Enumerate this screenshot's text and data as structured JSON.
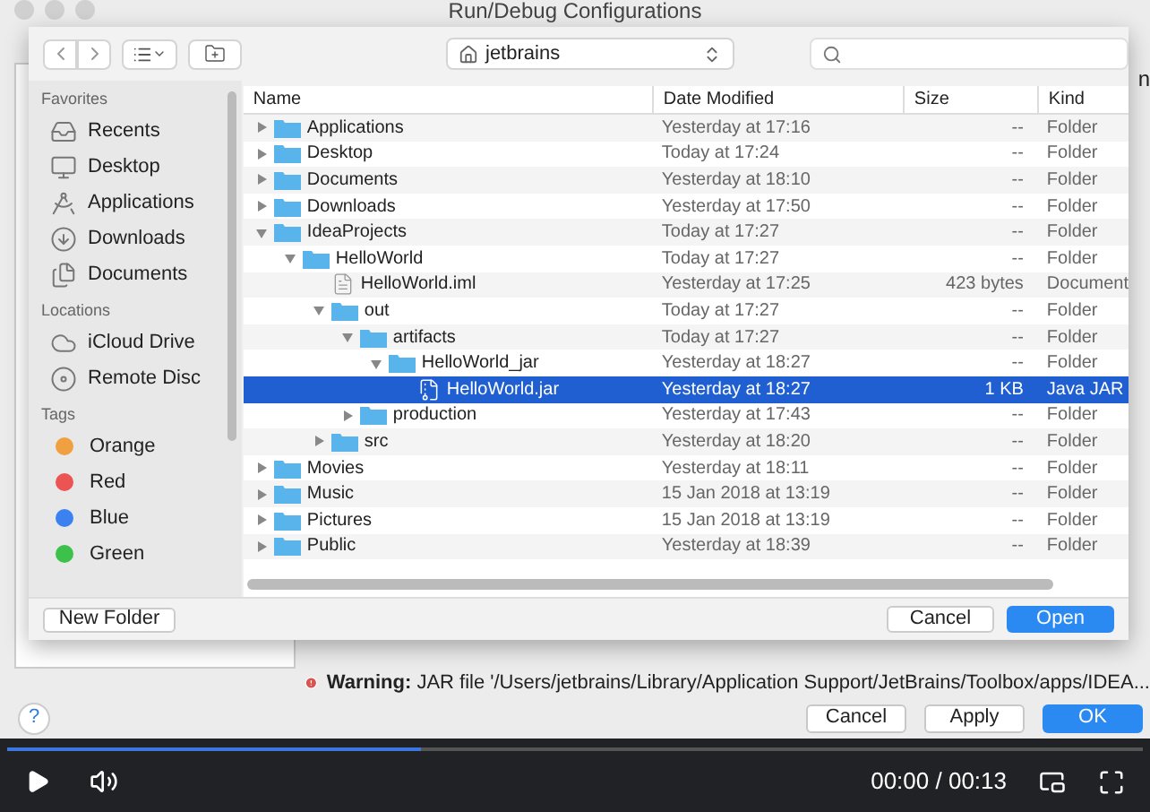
{
  "window": {
    "title": "Run/Debug Configurations",
    "cut_label": "n"
  },
  "toolbar": {
    "location": "jetbrains"
  },
  "sidebar": {
    "sections": [
      {
        "title": "Favorites",
        "items": [
          {
            "label": "Recents",
            "kind": "recents"
          },
          {
            "label": "Desktop",
            "kind": "desktop"
          },
          {
            "label": "Applications",
            "kind": "applications"
          },
          {
            "label": "Downloads",
            "kind": "downloads"
          },
          {
            "label": "Documents",
            "kind": "documents"
          }
        ]
      },
      {
        "title": "Locations",
        "items": [
          {
            "label": "iCloud Drive",
            "kind": "cloud"
          },
          {
            "label": "Remote Disc",
            "kind": "disc"
          }
        ]
      },
      {
        "title": "Tags",
        "items": [
          {
            "label": "Orange",
            "kind": "tag",
            "color": "#f0a040"
          },
          {
            "label": "Red",
            "kind": "tag",
            "color": "#ec5454"
          },
          {
            "label": "Blue",
            "kind": "tag",
            "color": "#3b82f0"
          },
          {
            "label": "Green",
            "kind": "tag",
            "color": "#3cc24a"
          }
        ]
      }
    ]
  },
  "table": {
    "columns": [
      "Name",
      "Date Modified",
      "Size",
      "Kind"
    ],
    "rows": [
      {
        "name": "Applications",
        "kind": "folder",
        "expanded": false,
        "selected": false,
        "date": "Yesterday at 17:16",
        "size": "--",
        "type": "Folder"
      },
      {
        "name": "Desktop",
        "kind": "folder",
        "expanded": false,
        "selected": false,
        "date": "Today at 17:24",
        "size": "--",
        "type": "Folder"
      },
      {
        "name": "Documents",
        "kind": "folder",
        "expanded": false,
        "selected": false,
        "date": "Yesterday at 18:10",
        "size": "--",
        "type": "Folder"
      },
      {
        "name": "Downloads",
        "kind": "folder",
        "expanded": false,
        "selected": false,
        "date": "Yesterday at 17:50",
        "size": "--",
        "type": "Folder"
      },
      {
        "name": "IdeaProjects",
        "kind": "folder",
        "expanded": true,
        "selected": false,
        "date": "Today at 17:27",
        "size": "--",
        "type": "Folder",
        "children": [
          {
            "name": "HelloWorld",
            "kind": "folder",
            "expanded": true,
            "selected": false,
            "date": "Today at 17:27",
            "size": "--",
            "type": "Folder",
            "children": [
              {
                "name": "HelloWorld.iml",
                "kind": "file",
                "selected": false,
                "date": "Yesterday at 17:25",
                "size": "423 bytes",
                "type": "Document"
              },
              {
                "name": "out",
                "kind": "folder",
                "expanded": true,
                "selected": false,
                "date": "Today at 17:27",
                "size": "--",
                "type": "Folder",
                "children": [
                  {
                    "name": "artifacts",
                    "kind": "folder",
                    "expanded": true,
                    "selected": false,
                    "date": "Today at 17:27",
                    "size": "--",
                    "type": "Folder",
                    "children": [
                      {
                        "name": "HelloWorld_jar",
                        "kind": "folder",
                        "expanded": true,
                        "selected": false,
                        "date": "Yesterday at 18:27",
                        "size": "--",
                        "type": "Folder",
                        "children": [
                          {
                            "name": "HelloWorld.jar",
                            "kind": "jar",
                            "selected": true,
                            "date": "Yesterday at 18:27",
                            "size": "1 KB",
                            "type": "Java JAR"
                          }
                        ]
                      }
                    ]
                  },
                  {
                    "name": "production",
                    "kind": "folder",
                    "expanded": false,
                    "selected": false,
                    "date": "Yesterday at 17:43",
                    "size": "--",
                    "type": "Folder"
                  }
                ]
              },
              {
                "name": "src",
                "kind": "folder",
                "expanded": false,
                "selected": false,
                "date": "Yesterday at 18:20",
                "size": "--",
                "type": "Folder"
              }
            ]
          }
        ]
      },
      {
        "name": "Movies",
        "kind": "folder",
        "expanded": false,
        "selected": false,
        "date": "Yesterday at 18:11",
        "size": "--",
        "type": "Folder"
      },
      {
        "name": "Music",
        "kind": "folder",
        "expanded": false,
        "selected": false,
        "date": "15 Jan 2018 at 13:19",
        "size": "--",
        "type": "Folder"
      },
      {
        "name": "Pictures",
        "kind": "folder",
        "expanded": false,
        "selected": false,
        "date": "15 Jan 2018 at 13:19",
        "size": "--",
        "type": "Folder"
      },
      {
        "name": "Public",
        "kind": "folder",
        "expanded": false,
        "selected": false,
        "date": "Yesterday at 18:39",
        "size": "--",
        "type": "Folder"
      }
    ]
  },
  "sheet_buttons": {
    "new_folder": "New Folder",
    "cancel": "Cancel",
    "open": "Open"
  },
  "warning": "**Warning:** JAR file '/Users/jetbrains/Library/Application Support/JetBrains/Toolbox/apps/IDEA...",
  "dialog_buttons": {
    "help": "?",
    "cancel": "Cancel",
    "apply": "Apply",
    "ok": "OK"
  },
  "player": {
    "level": 0.365,
    "time": "00:00 / 00:13"
  }
}
